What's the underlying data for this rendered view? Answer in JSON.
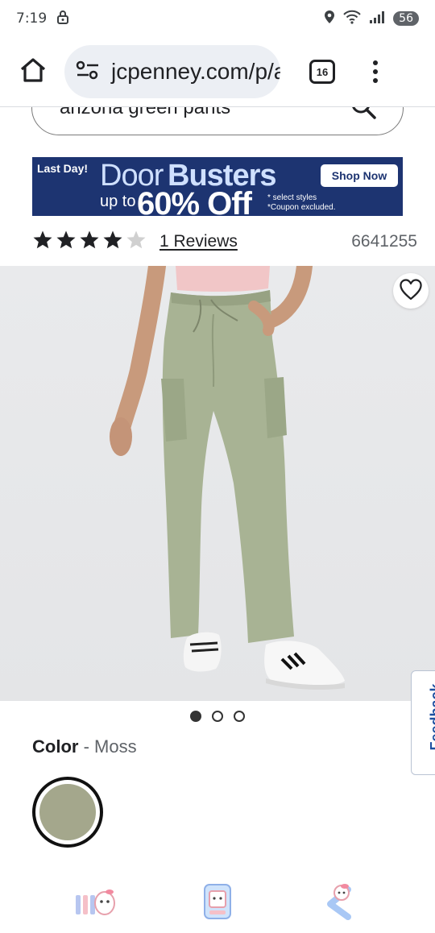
{
  "status": {
    "time": "7:19",
    "battery": "56"
  },
  "browser": {
    "url": "jcpenney.com/p/a",
    "tab_count": "16"
  },
  "search": {
    "query": "arizona green pants"
  },
  "promo_banner": {
    "last_day": "Last Day!",
    "door": "Door",
    "busters": "Busters",
    "up_to": "up to",
    "percent_off": "60% Off",
    "fine_print_1": "* select styles",
    "fine_print_2": "*Coupon excluded.",
    "cta": "Shop Now"
  },
  "product": {
    "rating": 4,
    "max_rating": 5,
    "reviews_label": "1 Reviews",
    "sku": "6641255",
    "image_count": 3,
    "active_image_index": 0,
    "color_label": "Color",
    "color_separator": " - ",
    "color_value": "Moss"
  },
  "feedback": {
    "label": "Feedback"
  },
  "colors": {
    "banner_bg": "#1d3471",
    "swatch": "#a4a78c",
    "pants": "#a8b394",
    "feedback": "#1d4fa0"
  },
  "icons": {
    "home": "home-icon",
    "site_settings": "site-settings-icon",
    "search": "search-icon",
    "heart": "heart-icon",
    "menu": "more-vert-icon"
  }
}
